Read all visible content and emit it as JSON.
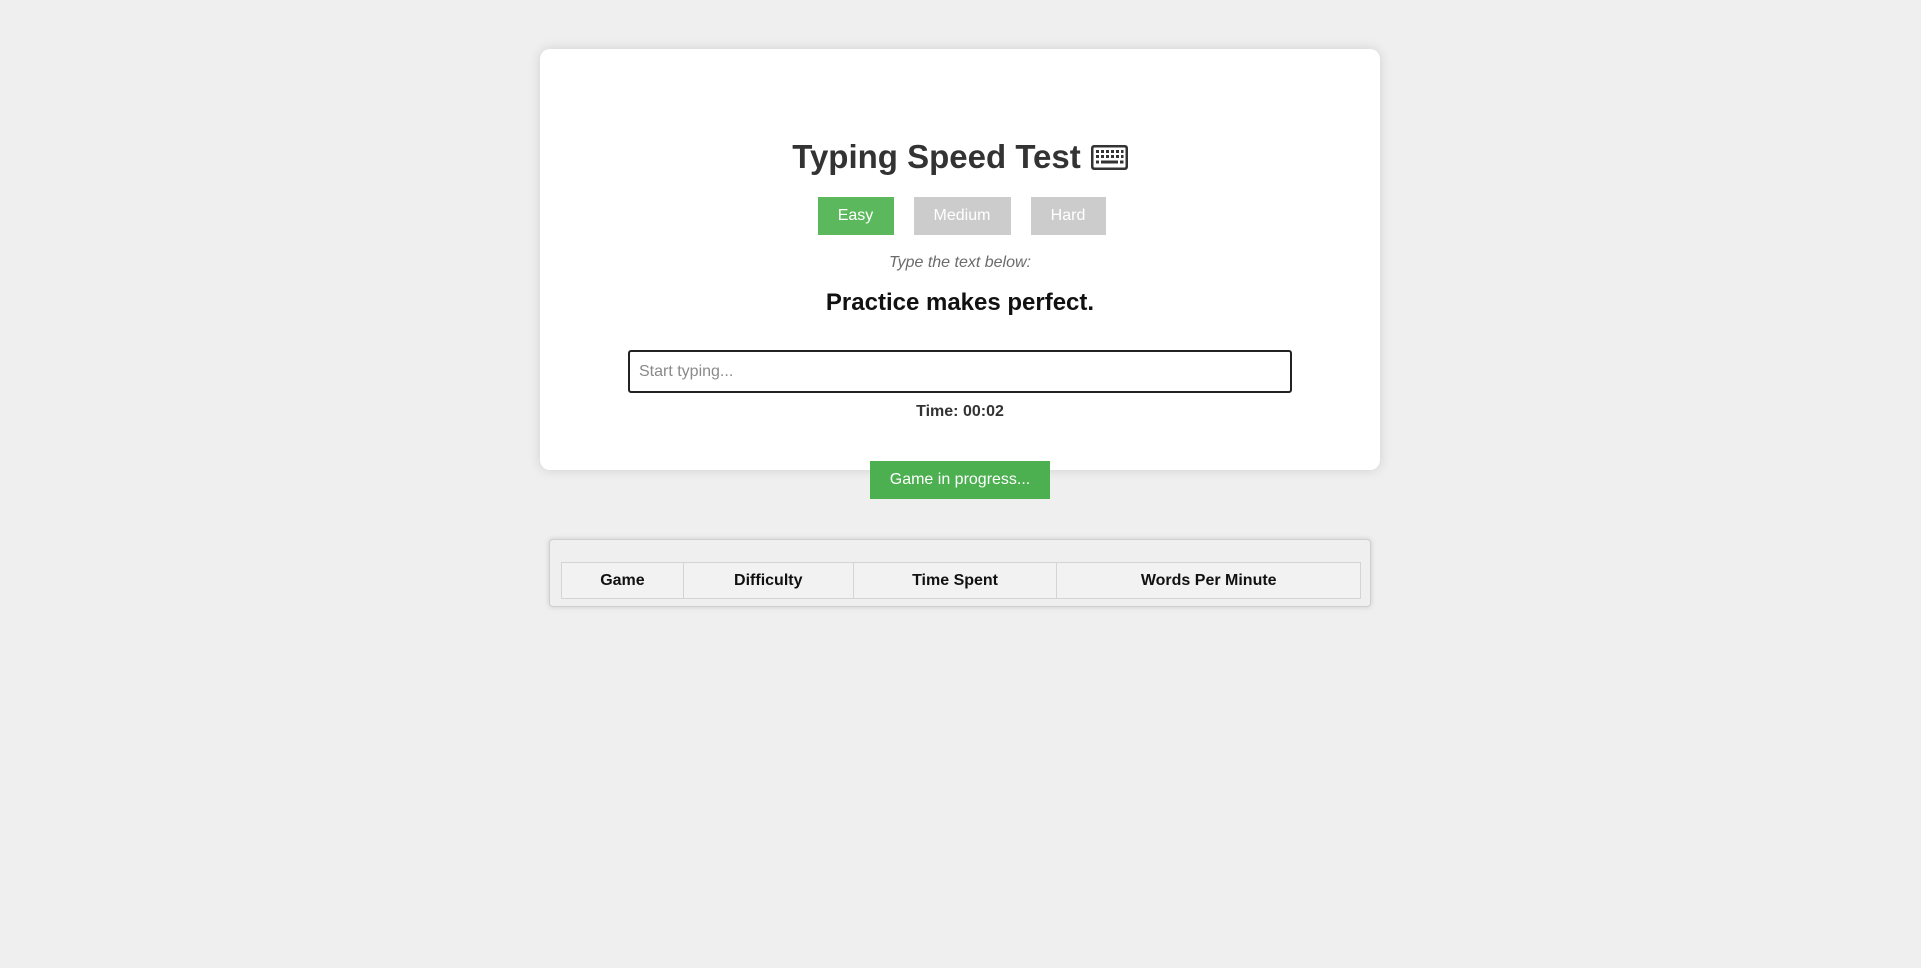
{
  "header": {
    "title": "Typing Speed Test",
    "title_icon": "keyboard-icon"
  },
  "difficulty": {
    "options": [
      {
        "label": "Easy",
        "selected": true
      },
      {
        "label": "Medium",
        "selected": false
      },
      {
        "label": "Hard",
        "selected": false
      }
    ]
  },
  "prompt": {
    "instruction": "Type the text below:",
    "target_text": "Practice makes perfect."
  },
  "input": {
    "value": "",
    "placeholder": "Start typing..."
  },
  "timer": {
    "text": "Time: 00:02"
  },
  "status_button": {
    "label": "Game in progress..."
  },
  "results": {
    "columns": [
      "Game",
      "Difficulty",
      "Time Spent",
      "Words Per Minute"
    ],
    "rows": []
  },
  "colors": {
    "background": "#efefef",
    "active_button": "#5cb85c",
    "inactive_button": "#cccccc",
    "status_button": "#4caf50"
  }
}
